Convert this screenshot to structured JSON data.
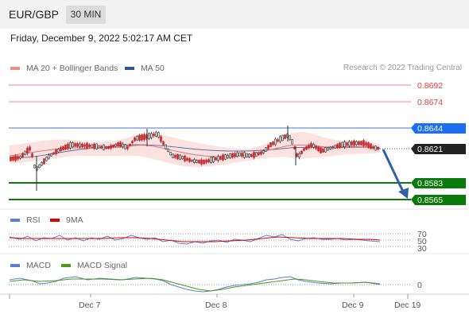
{
  "header": {
    "symbol": "EUR/GBP",
    "timeframe": "30 MIN",
    "date_text": "Friday, December 9, 2022 5:02:17 AM CET"
  },
  "main_chart": {
    "legend": [
      {
        "label": "MA 20 + Bollinger Bands",
        "color": "#f28b82"
      },
      {
        "label": "MA 50",
        "color": "#2e5597"
      }
    ],
    "credit": "Research © 2022 Trading Central",
    "levels": [
      {
        "value": "0.8692",
        "kind": "resistance"
      },
      {
        "value": "0.8674",
        "kind": "resistance"
      },
      {
        "value": "0.8644",
        "kind": "pivot"
      },
      {
        "value": "0.8621",
        "kind": "last"
      },
      {
        "value": "0.8583",
        "kind": "support"
      },
      {
        "value": "0.8565",
        "kind": "support"
      }
    ]
  },
  "rsi_panel": {
    "legend": [
      {
        "label": "RSI",
        "color": "#5b7fd6"
      },
      {
        "label": "9MA",
        "color": "#e00000"
      }
    ],
    "ticks": [
      "70",
      "50",
      "30"
    ]
  },
  "macd_panel": {
    "legend": [
      {
        "label": "MACD",
        "color": "#5b7fd6"
      },
      {
        "label": "MACD Signal",
        "color": "#4a9a1a"
      }
    ],
    "ticks": [
      "0"
    ]
  },
  "x_axis": {
    "labels": [
      "Dec 7",
      "Dec 8",
      "Dec 9",
      "Dec 19"
    ]
  },
  "colors": {
    "resistance": "#e53935",
    "pivot": "#5b8fd6",
    "support": "#0a7a0a",
    "last_bg": "#222222",
    "pivot_bg": "#1e6ef0",
    "support_bg": "#0a7a0a",
    "arrow": "#2e5fa8",
    "up_candle": "#2a2a2a",
    "down_candle": "#c62828"
  }
}
